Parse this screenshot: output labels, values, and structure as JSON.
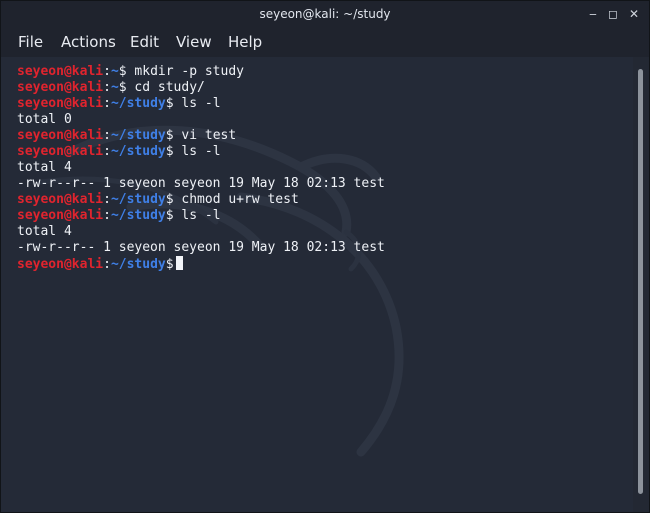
{
  "window": {
    "title": "seyeon@kali: ~/study"
  },
  "window_controls": {
    "minimize": "‒",
    "maximize": "◻",
    "close": "✕"
  },
  "menu": [
    "File",
    "Actions",
    "Edit",
    "View",
    "Help"
  ],
  "prompt": {
    "user": "seyeon",
    "at": "@",
    "host": "kali",
    "dollar": "$"
  },
  "lines": [
    {
      "type": "prompt",
      "path": "~",
      "cmd": " mkdir -p study"
    },
    {
      "type": "prompt",
      "path": "~",
      "cmd": " cd study/"
    },
    {
      "type": "prompt",
      "path": "~/study",
      "cmd": " ls -l"
    },
    {
      "type": "output",
      "text": "total 0"
    },
    {
      "type": "prompt",
      "path": "~/study",
      "cmd": " vi test"
    },
    {
      "type": "prompt",
      "path": "~/study",
      "cmd": " ls -l"
    },
    {
      "type": "output",
      "text": "total 4"
    },
    {
      "type": "output",
      "text": "-rw-r--r-- 1 seyeon seyeon 19 May 18 02:13 test"
    },
    {
      "type": "prompt",
      "path": "~/study",
      "cmd": " chmod u+rw test"
    },
    {
      "type": "prompt",
      "path": "~/study",
      "cmd": " ls -l"
    },
    {
      "type": "output",
      "text": "total 4"
    },
    {
      "type": "output",
      "text": "-rw-r--r-- 1 seyeon seyeon 19 May 18 02:13 test"
    },
    {
      "type": "prompt",
      "path": "~/study",
      "cmd": "",
      "cursor": true
    }
  ],
  "colors": {
    "user": "#e0242e",
    "path": "#3f7fe6",
    "background": "#242a37"
  }
}
